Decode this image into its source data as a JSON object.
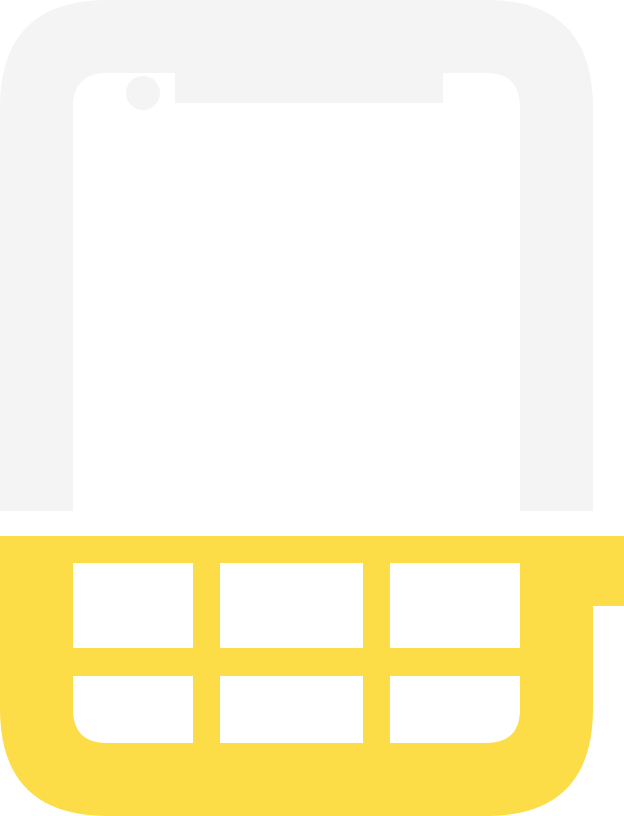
{
  "illustration": {
    "subject": "phone-with-keypad-icon",
    "colors": {
      "background": "#ffffff",
      "frame": "#f4f4f4",
      "screen": "#ffffff",
      "keypad": "#fddd47",
      "key": "#ffffff"
    },
    "keypad": {
      "rows": 2,
      "columns": 3
    }
  }
}
